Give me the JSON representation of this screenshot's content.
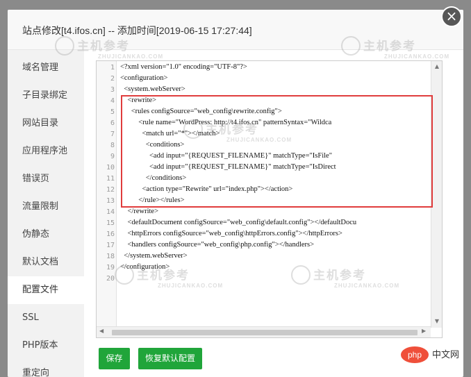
{
  "dialog": {
    "title": "站点修改[t4.ifos.cn] -- 添加时间[2019-06-15 17:27:44]",
    "close_label": "×"
  },
  "sidebar": {
    "items": [
      {
        "label": "域名管理"
      },
      {
        "label": "子目录绑定"
      },
      {
        "label": "网站目录"
      },
      {
        "label": "应用程序池"
      },
      {
        "label": "错误页"
      },
      {
        "label": "流量限制"
      },
      {
        "label": "伪静态"
      },
      {
        "label": "默认文档"
      },
      {
        "label": "配置文件",
        "active": true
      },
      {
        "label": "SSL"
      },
      {
        "label": "PHP版本"
      },
      {
        "label": "重定向"
      }
    ]
  },
  "editor": {
    "lines": [
      "<?xml version=\"1.0\" encoding=\"UTF-8\"?>",
      "<configuration>",
      "  <system.webServer>",
      "    <rewrite>",
      "      <rules configSource=\"web_config\\rewrite.config\">",
      "          <rule name=\"WordPress: http://t4.ifos.cn\" patternSyntax=\"Wildca",
      "            <match url=\"*\"></match>",
      "              <conditions>",
      "                <add input=\"{REQUEST_FILENAME}\" matchType=\"IsFile\"",
      "                <add input=\"{REQUEST_FILENAME}\" matchType=\"IsDirect",
      "              </conditions>",
      "            <action type=\"Rewrite\" url=\"index.php\"></action>",
      "          </rule></rules>",
      "    </rewrite>",
      "    <defaultDocument configSource=\"web_config\\default.config\"></defaultDocu",
      "    <httpErrors configSource=\"web_config\\httpErrors.config\"></httpErrors>",
      "    <handlers configSource=\"web_config\\php.config\"></handlers>",
      "  </system.webServer>",
      "</configuration>",
      ""
    ],
    "line_numbers": [
      "1",
      "2",
      "3",
      "4",
      "5",
      "6",
      "7",
      "8",
      "9",
      "10",
      "11",
      "12",
      "13",
      "14",
      "15",
      "16",
      "17",
      "18",
      "19",
      "20"
    ]
  },
  "buttons": {
    "save_label": "保存",
    "restore_label": "恢复默认配置"
  },
  "watermarks": {
    "brand": "主机参考",
    "sub": "ZHUJICANKAO.COM"
  },
  "footer_brand": {
    "badge": "php",
    "text": "中文网"
  },
  "colors": {
    "accent_green": "#20a53a",
    "highlight_red": "#e03c3c",
    "close_bg": "#575757"
  }
}
